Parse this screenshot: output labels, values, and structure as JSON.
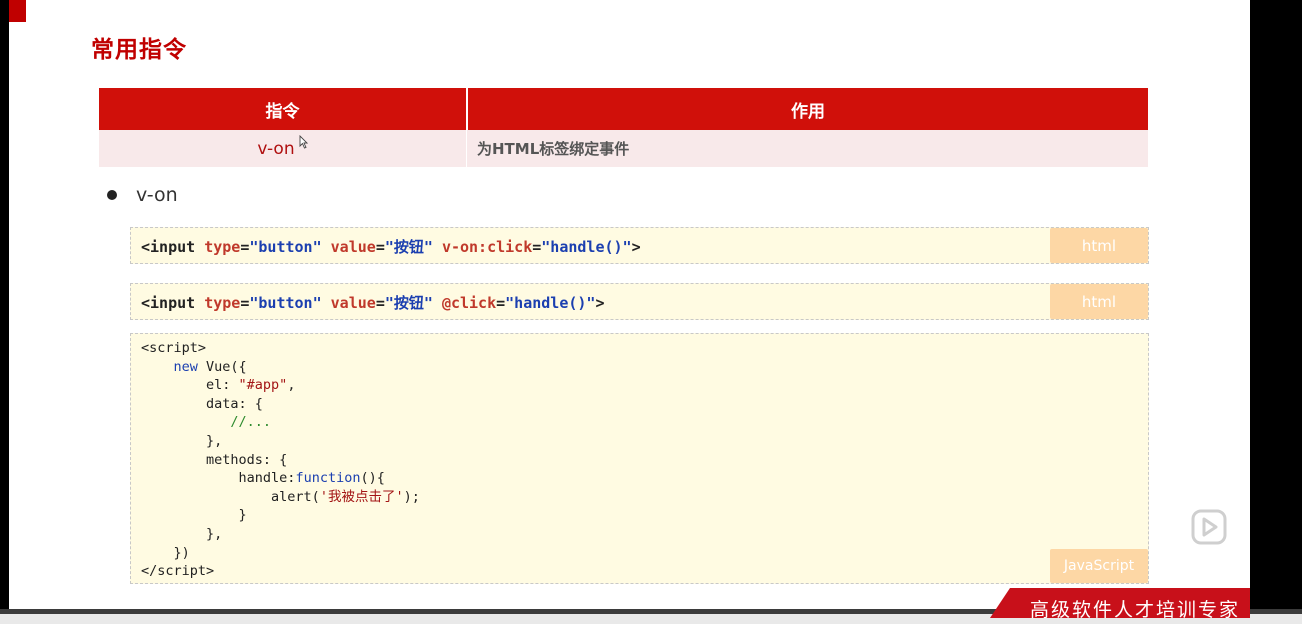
{
  "slide": {
    "title": "常用指令",
    "table": {
      "headers": [
        "指令",
        "作用"
      ],
      "rows": [
        {
          "directive": "v-on",
          "purpose": "为HTML标签绑定事件"
        }
      ]
    },
    "bullet": "v-on",
    "code_blocks": [
      {
        "lang": "html"
      },
      {
        "lang": "html"
      },
      {
        "lang": "JavaScript"
      }
    ]
  },
  "overlay": {
    "banner_text": "高级软件人才培训专家",
    "play_icon": "play-icon"
  },
  "colors": {
    "accent": "#c00000",
    "table_header": "#d0100a",
    "table_row": "#f8e9ea",
    "code_bg": "#fffbe2",
    "lang_tag": "#fdd7a5"
  }
}
